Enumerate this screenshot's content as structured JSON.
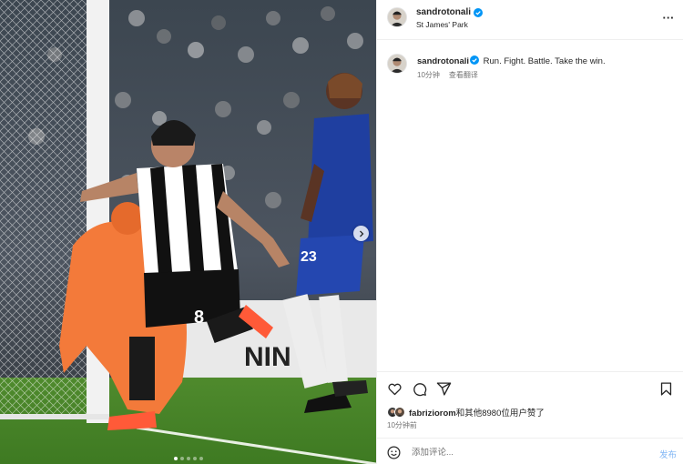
{
  "post": {
    "username": "sandrotonali",
    "location": "St James' Park",
    "caption_text": "Run. Fight. Battle. Take the win.",
    "caption_time": "10分钟",
    "see_translation": "查看翻译",
    "verified_color": "#0095f6"
  },
  "media": {
    "description_icon": "photo",
    "carousel": {
      "total": 5,
      "active": 0
    },
    "next_icon": "chevron-right-icon",
    "jersey_number_home": "8",
    "jersey_number_away": "23"
  },
  "actions": {
    "like_icon": "heart-icon",
    "comment_icon": "comment-icon",
    "share_icon": "send-icon",
    "save_icon": "bookmark-icon"
  },
  "likes": {
    "liker": "fabriziorom",
    "rest": "和其他8980位用户赞了"
  },
  "timestamp": "10分钟前",
  "comment": {
    "placeholder": "添加评论...",
    "post_label": "发布",
    "post_color": "#7fb5f5"
  }
}
